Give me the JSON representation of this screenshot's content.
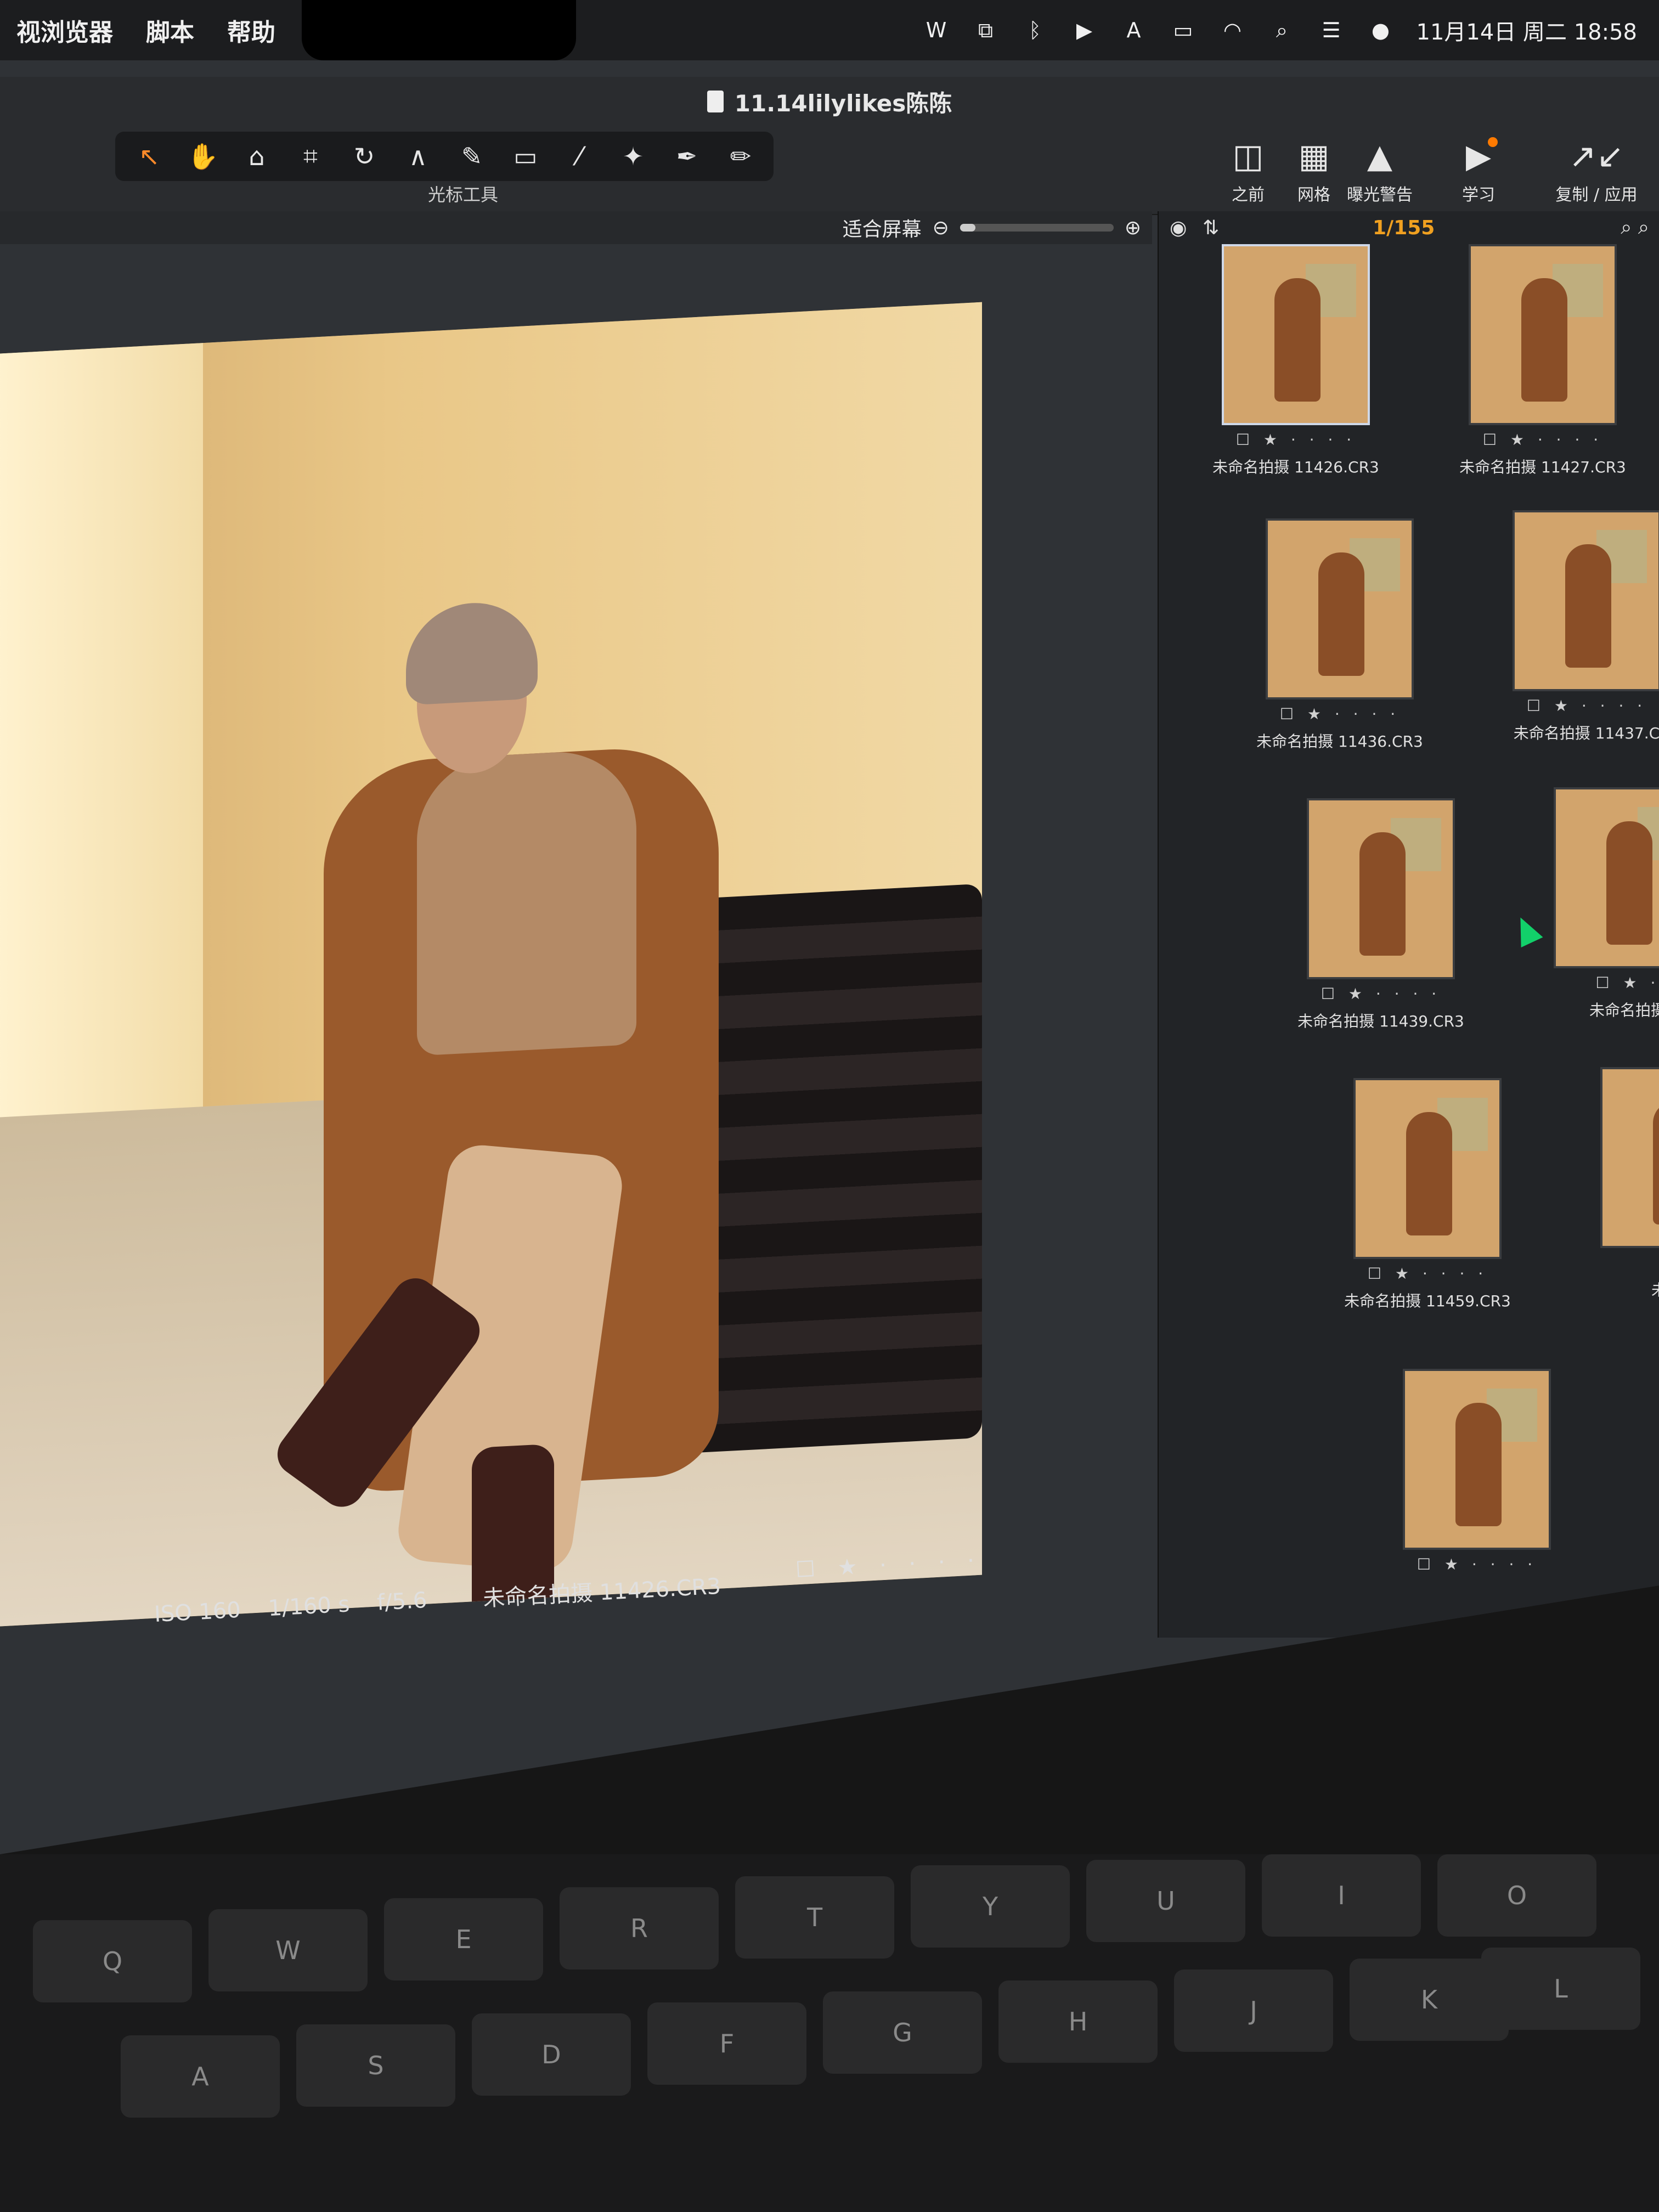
{
  "menubar": {
    "items": [
      "视浏览器",
      "脚本",
      "帮助"
    ],
    "status_text": "11月14日 周二 18:58",
    "icons": [
      "wps-icon",
      "sync-icon",
      "bluetooth-icon",
      "play-icon",
      "input-method-icon",
      "battery-icon",
      "wifi-icon",
      "search-icon",
      "control-center-icon",
      "siri-icon"
    ]
  },
  "window": {
    "title": "11.14lilylikes陈陈"
  },
  "toolbar": {
    "group_label": "光标工具",
    "right_tools": [
      {
        "label": "之前",
        "icon": "compare-icon"
      },
      {
        "label": "网格",
        "icon": "grid-icon"
      },
      {
        "label": "曝光警告",
        "icon": "exposure-warning-icon"
      },
      {
        "label": "学习",
        "icon": "learn-icon"
      },
      {
        "label": "复制 / 应用",
        "icon": "copy-apply-icon"
      }
    ]
  },
  "viewer": {
    "zoom_label": "适合屏幕",
    "zoom_level": 0.1,
    "iso": "ISO 160",
    "shutter": "1/160 s",
    "aperture": "f/5.6",
    "filename": "未命名拍摄 11426.CR3",
    "rating_stars": "★ · · · ·"
  },
  "filmstrip": {
    "counter": "1/155",
    "thumbs": [
      {
        "caption": "未命名拍摄 11426.CR3",
        "stars": "☐ ★ · · · ·",
        "selected": true
      },
      {
        "caption": "未命名拍摄 11427.CR3",
        "stars": "☐ ★ · · · ·",
        "selected": false
      },
      {
        "caption": "未命名拍摄 11436.CR3",
        "stars": "☐ ★ · · · ·",
        "selected": false
      },
      {
        "caption": "未命名拍摄 11437.C",
        "stars": "☐ ★ · · · ·",
        "selected": false
      },
      {
        "caption": "未命名拍摄 11439.CR3",
        "stars": "☐ ★ · · · ·",
        "selected": false
      },
      {
        "caption": "未命名拍摄",
        "stars": "☐ ★ ·",
        "selected": false
      },
      {
        "caption": "未命名拍摄 11459.CR3",
        "stars": "☐ ★ · · · ·",
        "selected": false
      },
      {
        "caption": "未命名",
        "stars": "☐",
        "selected": false
      },
      {
        "caption": "",
        "stars": "☐ ★ · · · ·",
        "selected": false
      }
    ]
  },
  "colors": {
    "accent_counter": "#f0a020",
    "cursor": "#12d06a",
    "learn_badge": "#ff7a00"
  }
}
